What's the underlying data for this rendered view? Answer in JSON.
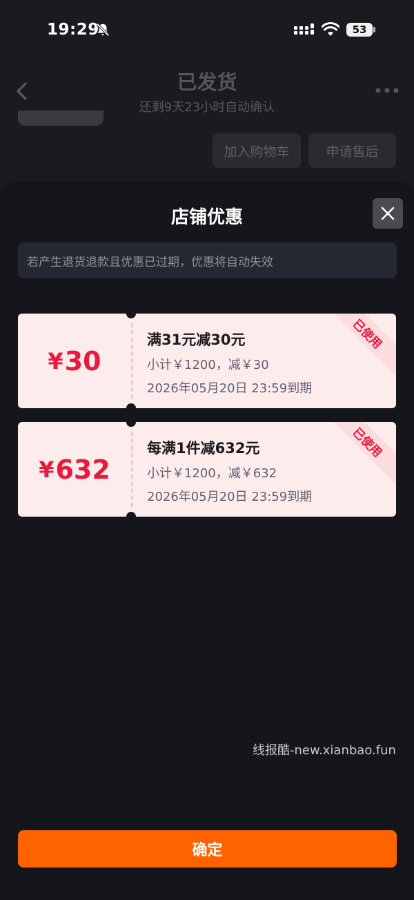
{
  "status_bar": {
    "time": "19:29",
    "battery": "53"
  },
  "background_page": {
    "title": "已发货",
    "subtitle": "还剩9天23小时自动确认",
    "buttons": {
      "add_to_cart": "加入购物车",
      "after_sales": "申请售后"
    }
  },
  "sheet": {
    "title": "店铺优惠",
    "notice": "若产生退货退款且优惠已过期，优惠将自动失效",
    "coupons": [
      {
        "currency": "¥",
        "amount": "30",
        "title": "满31元减30元",
        "subtotal": "小计￥1200，减￥30",
        "expiry": "2026年05月20日 23:59到期",
        "status": "已使用"
      },
      {
        "currency": "¥",
        "amount": "632",
        "title": "每满1件减632元",
        "subtotal": "小计￥1200，减￥632",
        "expiry": "2026年05月20日 23:59到期",
        "status": "已使用"
      }
    ],
    "confirm_label": "确定"
  },
  "watermark": "线报酷-new.xianbao.fun",
  "colors": {
    "accent": "#ff6200",
    "coupon_red": "#e8193c",
    "coupon_bg": "#fdecec"
  }
}
